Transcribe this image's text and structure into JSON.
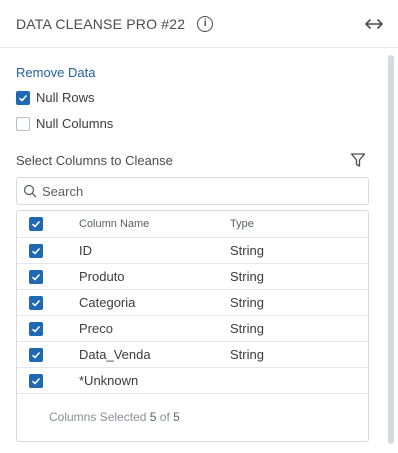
{
  "header": {
    "title": "DATA CLEANSE PRO #22",
    "info_icon": "info-icon",
    "expand_icon": "expand-horizontal-icon"
  },
  "remove_data": {
    "title": "Remove Data",
    "options": [
      {
        "label": "Null Rows",
        "checked": true
      },
      {
        "label": "Null Columns",
        "checked": false
      }
    ]
  },
  "select_columns": {
    "title": "Select Columns to Cleanse",
    "filter_icon": "filter-icon",
    "search": {
      "placeholder": "Search",
      "value": ""
    },
    "table": {
      "headers": {
        "name": "Column Name",
        "type": "Type"
      },
      "all_checked": true,
      "rows": [
        {
          "name": "ID",
          "type": "String",
          "checked": true
        },
        {
          "name": "Produto",
          "type": "String",
          "checked": true
        },
        {
          "name": "Categoria",
          "type": "String",
          "checked": true
        },
        {
          "name": "Preco",
          "type": "String",
          "checked": true
        },
        {
          "name": "Data_Venda",
          "type": "String",
          "checked": true
        },
        {
          "name": "*Unknown",
          "type": "",
          "checked": true
        }
      ]
    },
    "footer": {
      "prefix": "Columns Selected",
      "selected": "5",
      "of": "of",
      "total": "5"
    }
  },
  "colors": {
    "accent": "#1f68b3",
    "section_title": "#1f5fa0"
  }
}
